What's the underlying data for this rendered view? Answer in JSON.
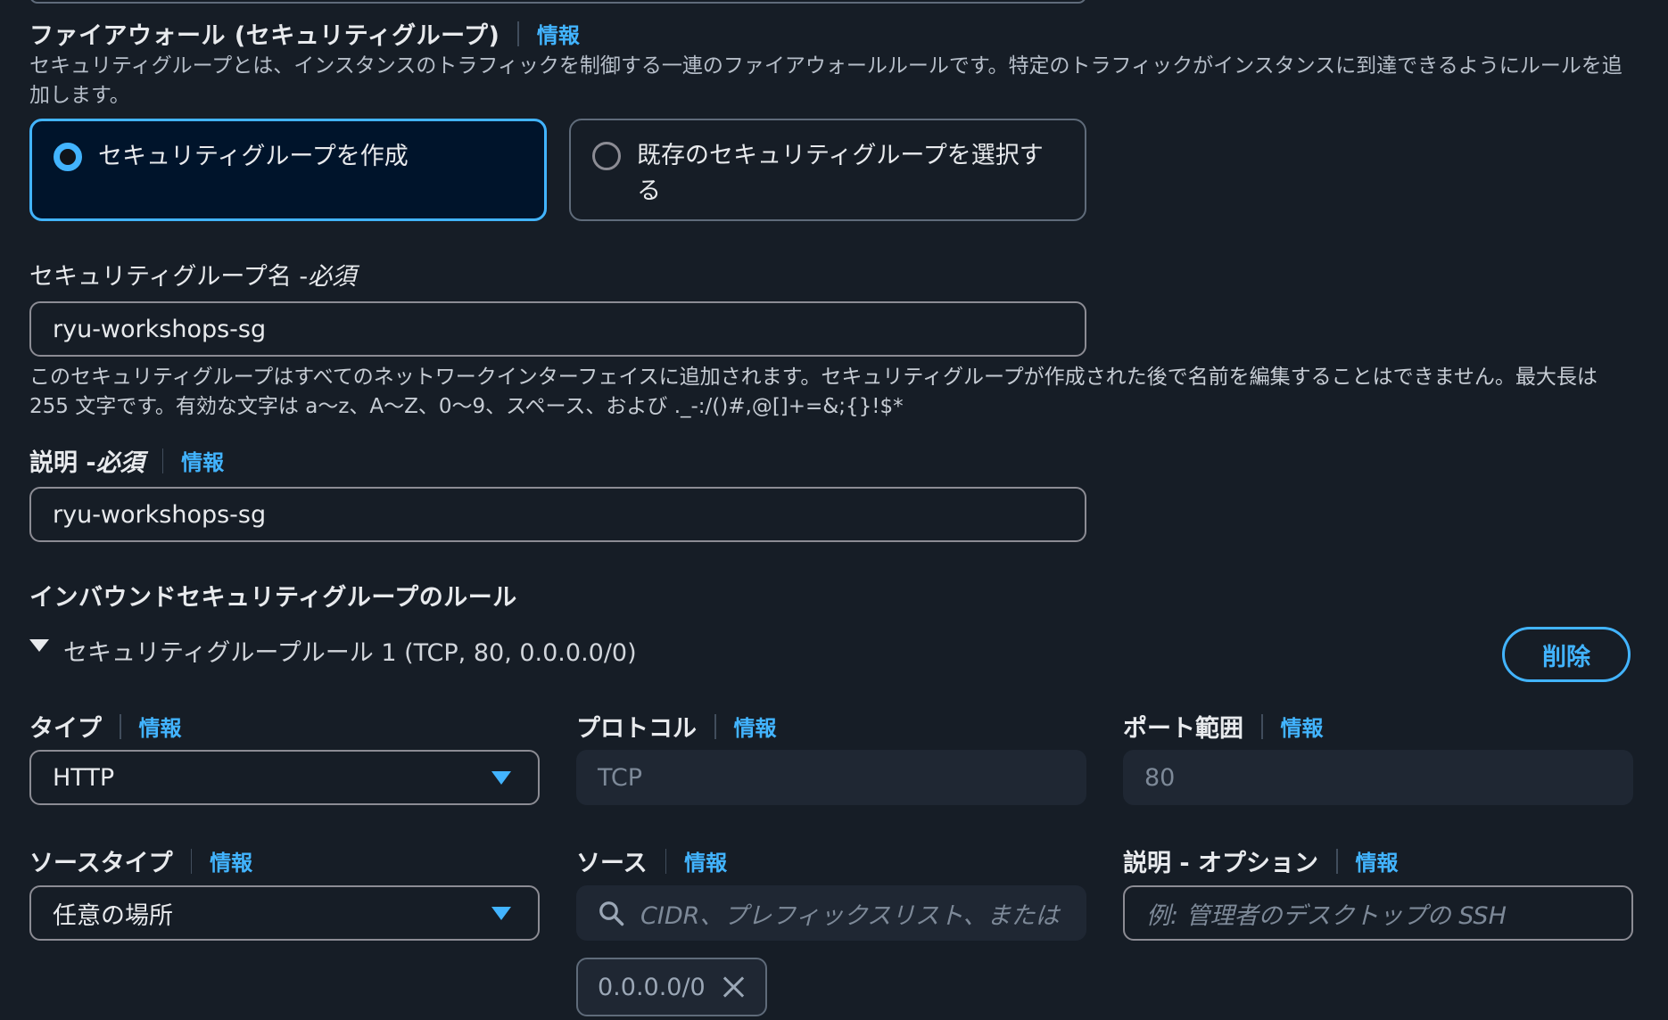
{
  "firewall": {
    "title": "ファイアウォール (セキュリティグループ)",
    "info": "情報",
    "description": "セキュリティグループとは、インスタンスのトラフィックを制御する一連のファイアウォールルールです。特定のトラフィックがインスタンスに到達できるようにルールを追加します。",
    "options": [
      {
        "label": "セキュリティグループを作成",
        "selected": true
      },
      {
        "label": "既存のセキュリティグループを選択する",
        "selected": false
      }
    ]
  },
  "sg_name": {
    "label": "セキュリティグループ名 - ",
    "required": "必須",
    "value": "ryu-workshops-sg",
    "hint": "このセキュリティグループはすべてのネットワークインターフェイスに追加されます。セキュリティグループが作成された後で名前を編集することはできません。最大長は 255 文字です。有効な文字は a〜z、A〜Z、0〜9、スペース、および ._-:/()#,@[]+=&;{}!$*"
  },
  "description_field": {
    "label": "説明 - ",
    "required": "必須",
    "info": "情報",
    "value": "ryu-workshops-sg"
  },
  "inbound": {
    "title": "インバウンドセキュリティグループのルール",
    "rule_title": "セキュリティグループルール 1 (TCP, 80, 0.0.0.0/0)",
    "delete_label": "削除",
    "type": {
      "label": "タイプ",
      "info": "情報",
      "value": "HTTP"
    },
    "protocol": {
      "label": "プロトコル",
      "info": "情報",
      "value": "TCP"
    },
    "port_range": {
      "label": "ポート範囲",
      "info": "情報",
      "value": "80"
    },
    "source_type": {
      "label": "ソースタイプ",
      "info": "情報",
      "value": "任意の場所"
    },
    "source": {
      "label": "ソース",
      "info": "情報",
      "placeholder": "CIDR、プレフィックスリスト、または",
      "token": "0.0.0.0/0"
    },
    "rule_desc": {
      "label": "説明 - オプション",
      "info": "情報",
      "placeholder": "例: 管理者のデスクトップの SSH"
    }
  },
  "colors": {
    "accent": "#42b4ff",
    "background": "#161d26",
    "selected_tile": "#00142b"
  }
}
